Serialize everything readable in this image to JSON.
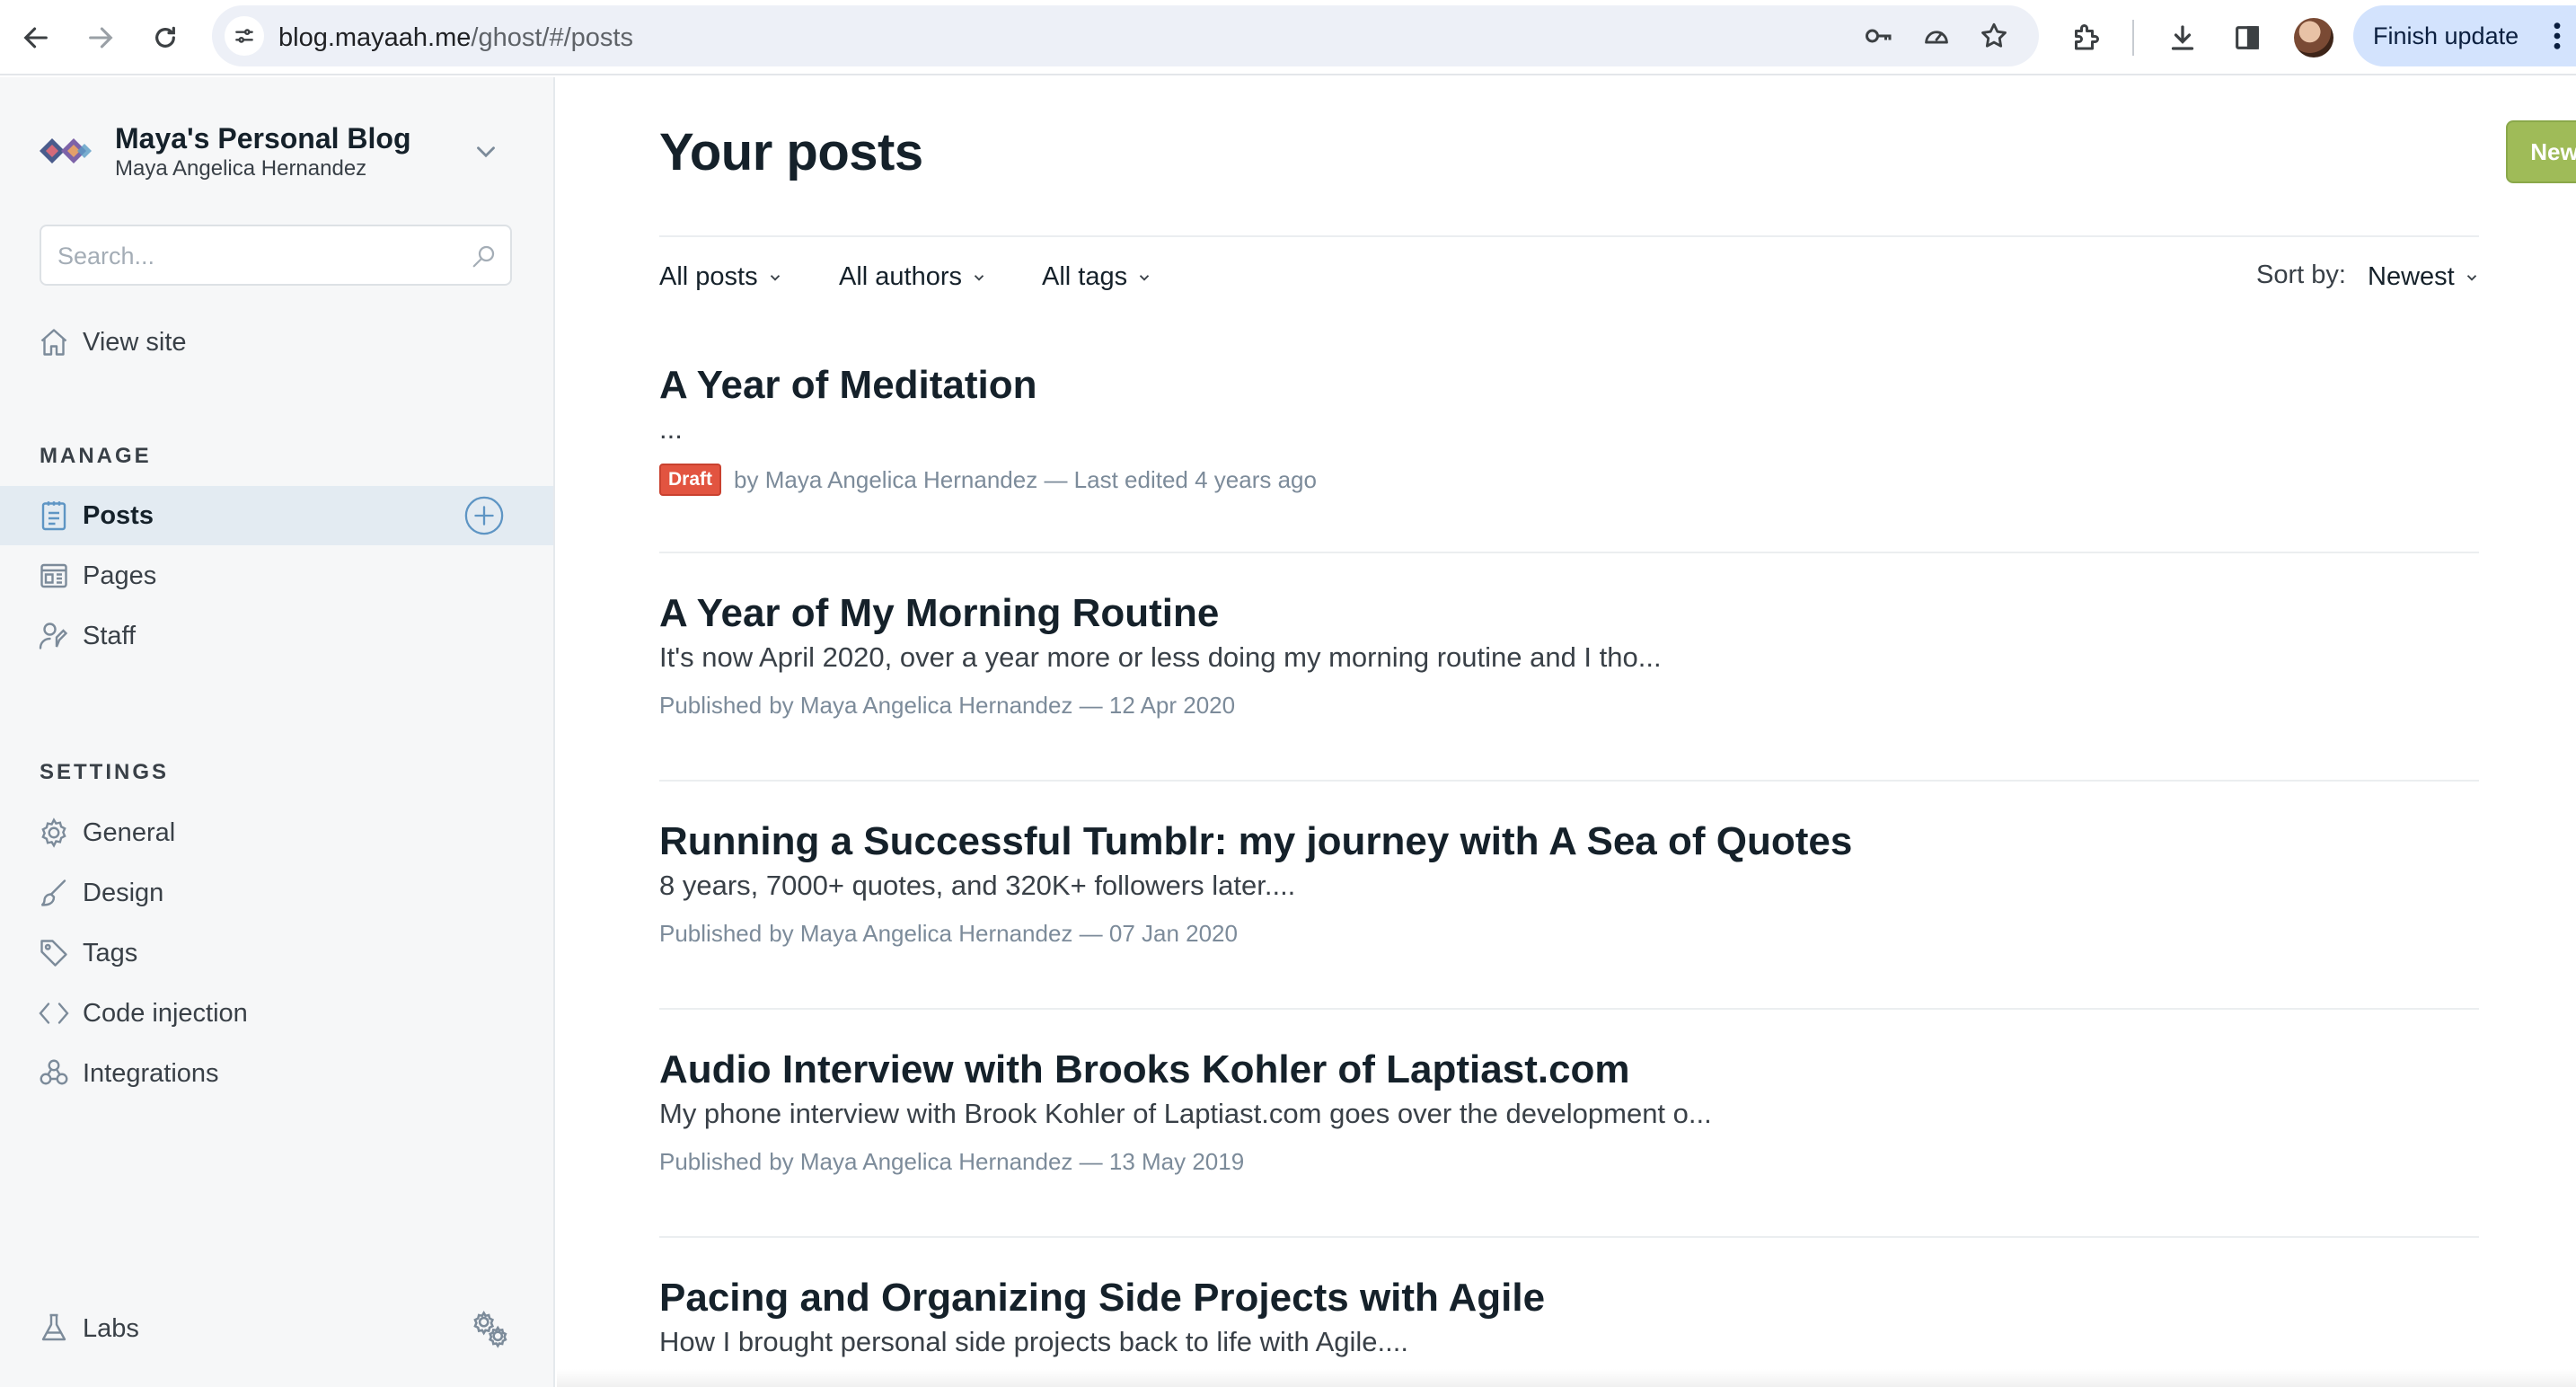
{
  "browser": {
    "url_host": "blog.mayaah.me",
    "url_path": "/ghost/#/posts",
    "finish_update_label": "Finish update"
  },
  "sidebar": {
    "blog_title": "Maya's Personal Blog",
    "blog_owner": "Maya Angelica Hernandez",
    "search_placeholder": "Search...",
    "view_site_label": "View site",
    "manage_heading": "MANAGE",
    "manage_items": [
      {
        "label": "Posts",
        "icon": "posts-icon",
        "active": true
      },
      {
        "label": "Pages",
        "icon": "pages-icon",
        "active": false
      },
      {
        "label": "Staff",
        "icon": "staff-icon",
        "active": false
      }
    ],
    "settings_heading": "SETTINGS",
    "settings_items": [
      {
        "label": "General",
        "icon": "gear-icon"
      },
      {
        "label": "Design",
        "icon": "brush-icon"
      },
      {
        "label": "Tags",
        "icon": "tag-icon"
      },
      {
        "label": "Code injection",
        "icon": "code-icon"
      },
      {
        "label": "Integrations",
        "icon": "integrations-icon"
      }
    ],
    "labs_label": "Labs"
  },
  "main": {
    "title": "Your posts",
    "new_post_label": "New post",
    "filters": {
      "status": "All posts",
      "authors": "All authors",
      "tags": "All tags"
    },
    "sort_label": "Sort by:",
    "sort_value": "Newest",
    "posts": [
      {
        "title": "A Year of Meditation",
        "excerpt": "...",
        "status": "Draft",
        "meta": "by Maya Angelica Hernandez — Last edited 4 years ago"
      },
      {
        "title": "A Year of My Morning Routine",
        "excerpt": "It's now April 2020, over a year more or less doing my morning routine and I tho...",
        "status": "Published",
        "meta": "by Maya Angelica Hernandez — 12 Apr 2020"
      },
      {
        "title": "Running a Successful Tumblr: my journey with A Sea of Quotes",
        "excerpt": "8 years, 7000+ quotes, and 320K+ followers later....",
        "status": "Published",
        "meta": "by Maya Angelica Hernandez — 07 Jan 2020"
      },
      {
        "title": "Audio Interview with Brooks Kohler of Laptiast.com",
        "excerpt": "My phone interview with Brook Kohler of Laptiast.com goes over the development o...",
        "status": "Published",
        "meta": "by Maya Angelica Hernandez — 13 May 2019"
      },
      {
        "title": "Pacing and Organizing Side Projects with Agile",
        "excerpt": "How I brought personal side projects back to life with Agile....",
        "status": "",
        "meta": ""
      }
    ]
  },
  "colors": {
    "accent_blue": "#5e95c4",
    "new_post_green": "#9fbb58",
    "draft_red": "#e25440"
  }
}
